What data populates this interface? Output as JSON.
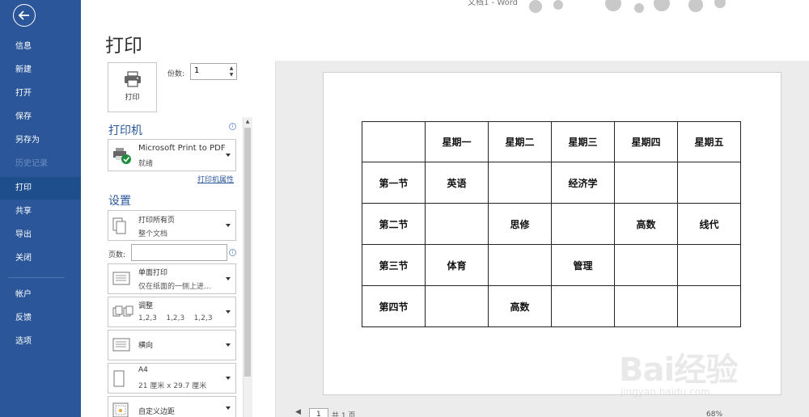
{
  "app": {
    "doc_title": "文档1 - Word"
  },
  "sidebar": {
    "items": [
      {
        "label": "信息"
      },
      {
        "label": "新建"
      },
      {
        "label": "打开"
      },
      {
        "label": "保存"
      },
      {
        "label": "另存为"
      },
      {
        "label": "历史记录"
      },
      {
        "label": "打印"
      },
      {
        "label": "共享"
      },
      {
        "label": "导出"
      },
      {
        "label": "关闭"
      },
      {
        "label": "帐户"
      },
      {
        "label": "反馈"
      },
      {
        "label": "选项"
      }
    ],
    "active": "打印",
    "disabled": "历史记录"
  },
  "print": {
    "heading": "打印",
    "button_label": "打印",
    "copies_label": "份数:",
    "copies_value": "1"
  },
  "printer": {
    "section_title": "打印机",
    "name": "Microsoft Print to PDF",
    "status": "就绪",
    "properties_link": "打印机属性"
  },
  "settings": {
    "section_title": "设置",
    "range": {
      "main": "打印所有页",
      "sub": "整个文档"
    },
    "pages_label": "页数:",
    "pages_value": "",
    "sides": {
      "main": "单面打印",
      "sub": "仅在纸面的一侧上进..."
    },
    "collate": {
      "main": "调整",
      "sub": "1,2,3    1,2,3    1,2,3"
    },
    "orientation": {
      "main": "横向"
    },
    "paper": {
      "main": "A4",
      "sub": "21 厘米 x 29.7 厘米"
    },
    "margins": {
      "main": "自定义边距"
    }
  },
  "preview": {
    "table": {
      "rows": [
        [
          "",
          "星期一",
          "星期二",
          "星期三",
          "星期四",
          "星期五"
        ],
        [
          "第一节",
          "英语",
          "",
          "经济学",
          "",
          ""
        ],
        [
          "第二节",
          "",
          "思修",
          "",
          "高数",
          "线代"
        ],
        [
          "第三节",
          "体育",
          "",
          "管理",
          "",
          ""
        ],
        [
          "第四节",
          "",
          "高数",
          "",
          "",
          ""
        ]
      ]
    },
    "page_number": "1",
    "page_total": "共 1 页",
    "zoom": "68%"
  },
  "watermark": {
    "text": "Bai经验",
    "sub": "jingyan.baidu.com"
  },
  "colors": {
    "sidebar": "#2b579a",
    "accent": "#2b579a",
    "active_item": "#1e4e8c"
  }
}
